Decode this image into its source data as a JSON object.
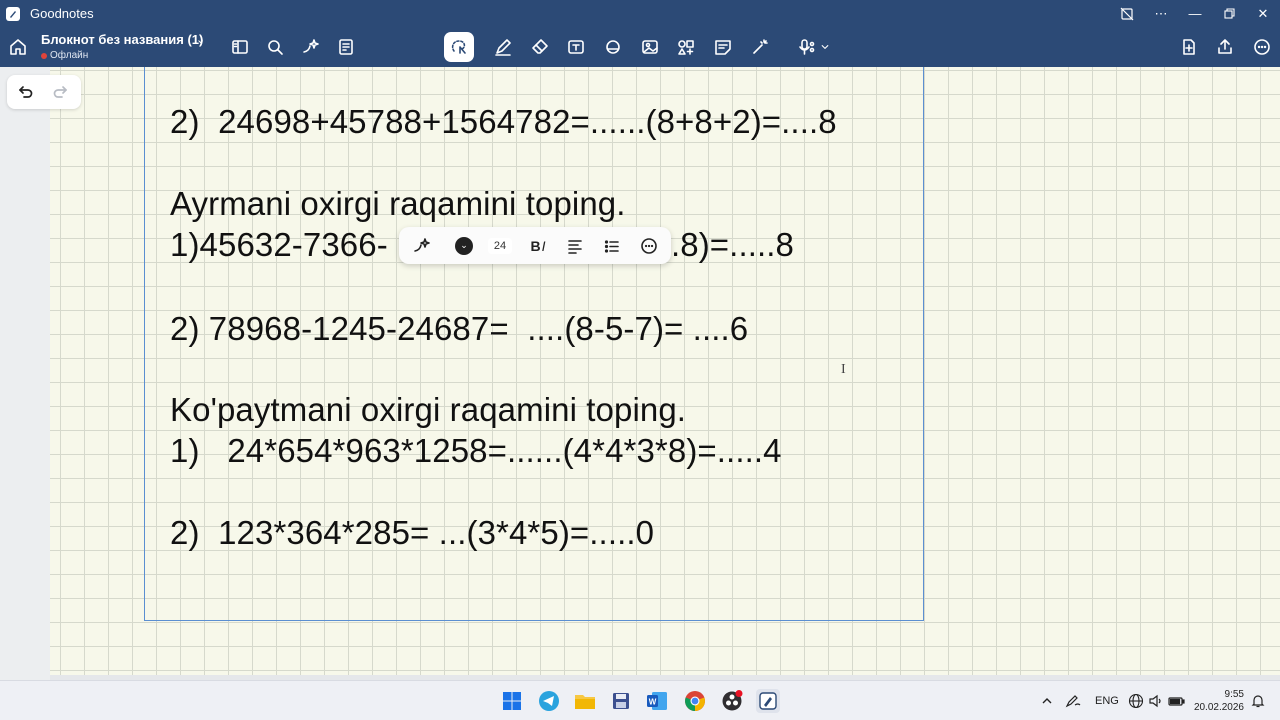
{
  "window": {
    "title": "Goodnotes"
  },
  "toolbar": {
    "notebook_title": "Блокнот без названия (1)",
    "status": "Офлайн"
  },
  "format_bar": {
    "font_size": "24"
  },
  "page": {
    "lines": [
      "2)  24698+45788+1564782=......(8+8+2)=....8",
      "Ayrmani oxirgi raqamini toping.",
      "1)45632-7366-",
      ".8)=.....8",
      "2) 78968-1245-24687=  ....(8-5-7)= ....6",
      "Ko'paytmani oxirgi raqamini toping.",
      "1)   24*654*963*1258=......(4*4*3*8)=.....4",
      "2)  123*364*285= ...(3*4*5)=.....0"
    ]
  },
  "taskbar": {
    "language": "ENG",
    "time": "9:55",
    "date": "20.02.2026"
  },
  "colors": {
    "chrome": "#2c4a76",
    "page_bg": "#f7f8ea",
    "textbox_border": "#5b8fd1"
  }
}
